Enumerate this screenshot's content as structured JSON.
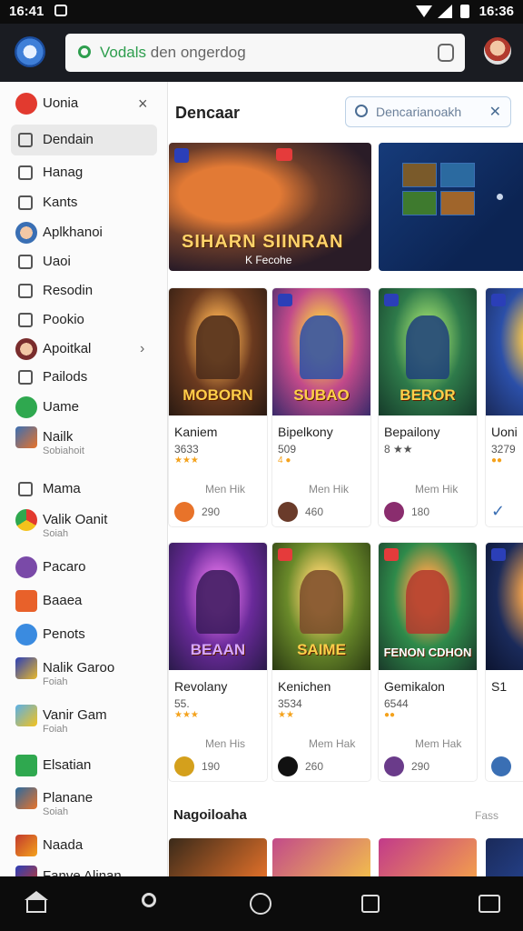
{
  "status_bar": {
    "time_left": "16:41",
    "time_right": "16:36"
  },
  "app_bar": {
    "url_highlight": "Vodals",
    "url_rest": " den ongerdog"
  },
  "drawer": {
    "items": [
      {
        "label": "Uonia",
        "icon": "red-circle-icon",
        "color": "#e23a2f"
      },
      {
        "label": "Dendain",
        "icon": "window-icon"
      },
      {
        "label": "Hanag",
        "icon": "person-icon"
      },
      {
        "label": "Kants",
        "icon": "person-icon"
      },
      {
        "label": "Aplkhanoi",
        "icon": "avatar-icon"
      },
      {
        "label": "Uaoi",
        "icon": "square-icon"
      },
      {
        "label": "Resodin",
        "icon": "building-icon"
      },
      {
        "label": "Pookio",
        "icon": "square-icon"
      },
      {
        "label": "Apoitkal",
        "icon": "avatar-icon"
      },
      {
        "label": "Pailods",
        "icon": "image-icon"
      },
      {
        "label": "Uame",
        "icon": "green-circle-icon"
      },
      {
        "label": "Nailk",
        "sub": "Sobiahoit",
        "icon": "game-icon"
      },
      {
        "label": "Mama",
        "icon": "square-icon"
      },
      {
        "label": "Valik Oanit",
        "sub": "Soiah",
        "icon": "chrome-icon"
      },
      {
        "label": "Pacaro",
        "icon": "purple-circle-icon"
      },
      {
        "label": "Baaea",
        "icon": "orange-square-icon"
      },
      {
        "label": "Penots",
        "icon": "blue-circle-icon"
      },
      {
        "label": "Nalik Garoo",
        "sub": "Foiah",
        "icon": "game-icon"
      },
      {
        "label": "Vanir Gam",
        "sub": "Foiah",
        "icon": "game-icon"
      },
      {
        "label": "Elsatian",
        "icon": "green-square-icon"
      },
      {
        "label": "Planane",
        "sub": "Soiah",
        "icon": "game-icon"
      },
      {
        "label": "Naada",
        "icon": "game-icon"
      },
      {
        "label": "Fanve Alinan",
        "icon": "game-icon"
      }
    ]
  },
  "main": {
    "title": "Dencaar",
    "search_placeholder": "Dencarianoakh",
    "banner": {
      "title": "SIHARN  SIINRAN",
      "subtitle": "K Fecohe"
    },
    "cards_row1": [
      {
        "art": "MOBORN",
        "title": "Kaniem",
        "meta": "3633",
        "stars": "★★★",
        "tags": "Men  Hik",
        "count": "290",
        "icon_color": "#e8732a"
      },
      {
        "art": "SUBAO",
        "title": "Bipelkony",
        "meta": "509",
        "stars": "4 ●",
        "tags": "Men  Hik",
        "count": "460",
        "icon_color": "#6a3b2a"
      },
      {
        "art": "BEROR",
        "title": "Bepailony",
        "meta": "8 ★★",
        "stars": "",
        "tags": "Mem  Hik",
        "count": "180",
        "icon_color": "#8a2d6e"
      },
      {
        "art": "",
        "title": "Uoni",
        "meta": "3279",
        "stars": "●●",
        "tags": "",
        "count": "",
        "icon_color": "#3a6fb4"
      }
    ],
    "cards_row2": [
      {
        "art": "BEAAN",
        "title": "Revolany",
        "meta": "55.",
        "stars": "★★★",
        "tags": "Men  His",
        "count": "190",
        "icon_color": "#d4a01c"
      },
      {
        "art": "SAIME",
        "title": "Kenichen",
        "meta": "3534",
        "stars": "★★",
        "tags": "Mem  Hak",
        "count": "260",
        "icon_color": "#111111"
      },
      {
        "art": "FENON CDHON",
        "title": "Gemikalon",
        "meta": "6544",
        "stars": "●●",
        "tags": "Mem  Hak",
        "count": "290",
        "icon_color": "#6a3b8a"
      },
      {
        "art": "",
        "title": "S1",
        "meta": "",
        "stars": "",
        "tags": "",
        "count": "",
        "icon_color": "#3a6fb4"
      }
    ],
    "section_title": "Nagoiloaha",
    "section_link": "Fass"
  }
}
